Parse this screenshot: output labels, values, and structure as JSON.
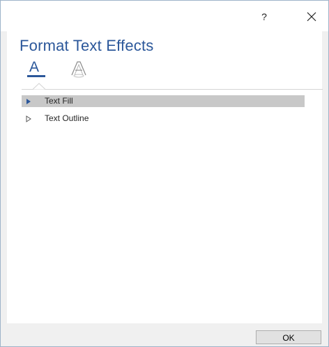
{
  "titlebar": {
    "help_label": "?",
    "close_icon": "close-icon"
  },
  "pane": {
    "title": "Format Text Effects",
    "tabs": [
      {
        "name": "text-fill-outline",
        "icon": "text-fill-outline-icon",
        "glyph": "A",
        "selected": true
      },
      {
        "name": "text-effects",
        "icon": "text-effects-icon",
        "selected": false
      }
    ],
    "sections": [
      {
        "label": "Text Fill",
        "expanded": false,
        "selected": true
      },
      {
        "label": "Text Outline",
        "expanded": false,
        "selected": false
      }
    ]
  },
  "footer": {
    "ok_label": "OK"
  },
  "colors": {
    "accent": "#2b579a",
    "selection": "#c8c8c8",
    "dialog_bg": "#f0f0f0"
  }
}
